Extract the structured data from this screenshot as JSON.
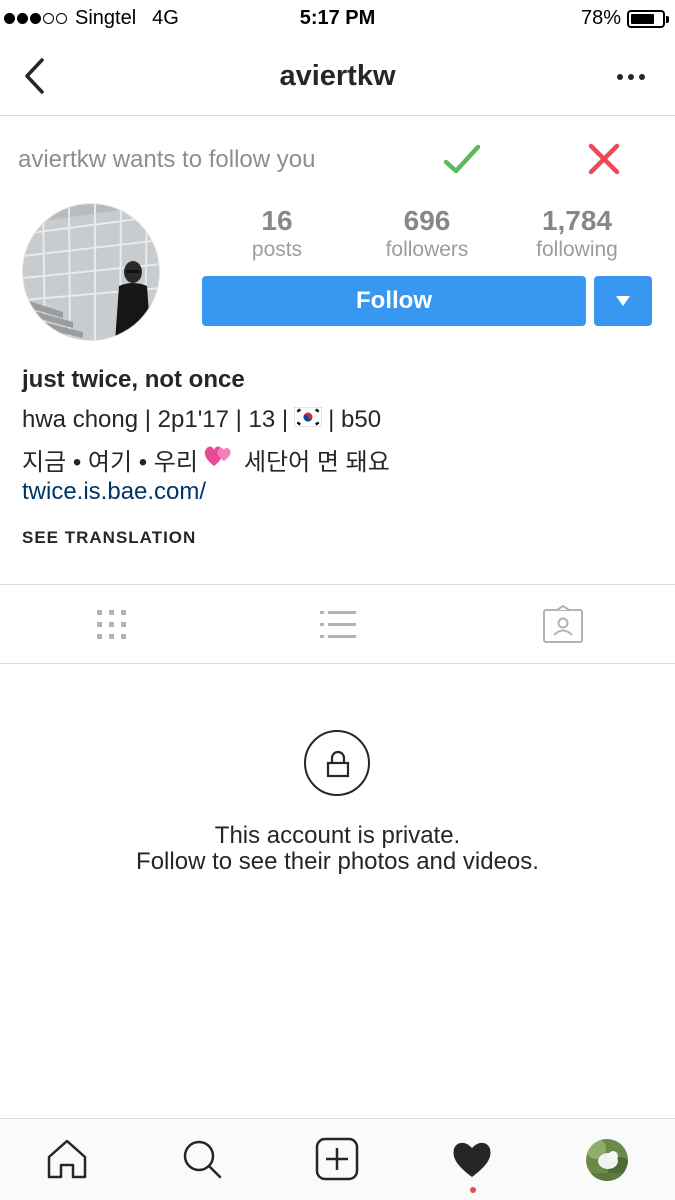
{
  "status_bar": {
    "signal_full": 3,
    "signal_total": 5,
    "carrier": "Singtel",
    "network": "4G",
    "time": "5:17 PM",
    "battery_text": "78%",
    "battery_level": 0.78
  },
  "nav": {
    "title": "aviertkw",
    "back_icon": "chevron-left-icon",
    "more_icon": "more-dots-icon"
  },
  "follow_request": {
    "text": "aviertkw wants to follow you",
    "accept_color": "#5cb85c",
    "decline_color": "#ed4956"
  },
  "stats": [
    {
      "value": "16",
      "label": "posts"
    },
    {
      "value": "696",
      "label": "followers"
    },
    {
      "value": "1,784",
      "label": "following"
    }
  ],
  "follow_button": {
    "label": "Follow",
    "color": "#3897f0"
  },
  "bio": {
    "name": "just twice, not once",
    "line1_before_flag": "hwa chong | 2p1'17 | 13 |",
    "line1_flag_icon": "south-korea-flag-icon",
    "line1_after_flag": "| b50",
    "line2_before_icon": "지금 • 여기 • 우리",
    "line2_icon": "two-hearts-icon",
    "line2_after_icon": "세단어 면 돼요",
    "link": "twice.is.bae.com/",
    "see_translation": "SEE TRANSLATION"
  },
  "tabs": [
    "grid-icon",
    "list-icon",
    "tagged-photos-icon"
  ],
  "private": {
    "line1": "This account is private.",
    "line2": "Follow to see their photos and videos."
  },
  "bottom_nav": [
    "home-icon",
    "search-icon",
    "new-post-icon",
    "activity-heart-icon",
    "profile-avatar"
  ],
  "colors": {
    "link": "#003569",
    "activity_dot": "#ed4956"
  }
}
